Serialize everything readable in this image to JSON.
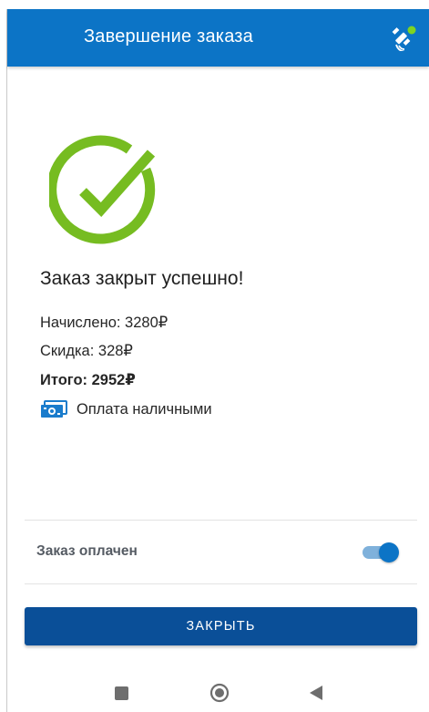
{
  "appbar": {
    "title": "Завершение заказа",
    "status_icon": "satellite-icon",
    "color": "#0c74c6",
    "status_dot_color": "#7ed321"
  },
  "result": {
    "icon": "check-circle-icon",
    "icon_color": "#76bc21",
    "headline": "Заказ закрыт успешно!",
    "accrued": "Начислено: 3280₽",
    "discount": "Скидка: 328₽",
    "total": "Итого: 2952₽",
    "payment_icon": "cash-icon",
    "payment_method": "Оплата наличными"
  },
  "paid_toggle": {
    "label": "Заказ оплачен",
    "checked": true
  },
  "actions": {
    "close_label": "ЗАКРЫТЬ",
    "close_color": "#0a4f98"
  },
  "system_nav": {
    "recents_icon": "square-icon",
    "home_icon": "circle-icon",
    "back_icon": "triangle-back-icon"
  }
}
